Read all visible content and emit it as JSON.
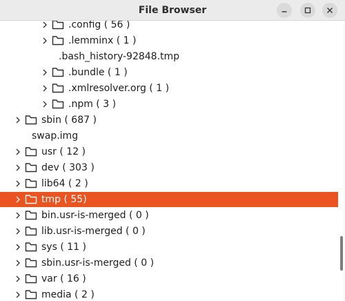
{
  "window": {
    "title": "File Browser"
  },
  "icons": {
    "minimize": "minimize-icon",
    "maximize": "maximize-icon",
    "close": "close-icon",
    "expander": "chevron-right-icon",
    "folder": "folder-icon"
  },
  "colors": {
    "selection": "#e95420",
    "titlebar": "#ebebeb",
    "text": "#1e1e1e"
  },
  "tree": {
    "selected_label": "tmp ( 55)",
    "rows": [
      {
        "label": ".config ( 56 )",
        "type": "folder",
        "depth": 2,
        "expandable": true
      },
      {
        "label": ".lemminx ( 1 )",
        "type": "folder",
        "depth": 2,
        "expandable": true
      },
      {
        "label": ".bash_history-92848.tmp",
        "type": "file",
        "depth": 2,
        "expandable": false
      },
      {
        "label": ".bundle ( 1 )",
        "type": "folder",
        "depth": 2,
        "expandable": true
      },
      {
        "label": ".xmlresolver.org ( 1 )",
        "type": "folder",
        "depth": 2,
        "expandable": true
      },
      {
        "label": ".npm ( 3 )",
        "type": "folder",
        "depth": 2,
        "expandable": true
      },
      {
        "label": "sbin ( 687 )",
        "type": "folder",
        "depth": 1,
        "expandable": true
      },
      {
        "label": "swap.img",
        "type": "file",
        "depth": 1,
        "expandable": false
      },
      {
        "label": "usr ( 12 )",
        "type": "folder",
        "depth": 1,
        "expandable": true
      },
      {
        "label": "dev ( 303 )",
        "type": "folder",
        "depth": 1,
        "expandable": true
      },
      {
        "label": "lib64 ( 2 )",
        "type": "folder",
        "depth": 1,
        "expandable": true
      },
      {
        "label": "tmp ( 55)",
        "type": "folder",
        "depth": 1,
        "expandable": true,
        "selected": true
      },
      {
        "label": "bin.usr-is-merged ( 0 )",
        "type": "folder",
        "depth": 1,
        "expandable": true
      },
      {
        "label": "lib.usr-is-merged ( 0 )",
        "type": "folder",
        "depth": 1,
        "expandable": true
      },
      {
        "label": "sys ( 11 )",
        "type": "folder",
        "depth": 1,
        "expandable": true
      },
      {
        "label": "sbin.usr-is-merged ( 0 )",
        "type": "folder",
        "depth": 1,
        "expandable": true
      },
      {
        "label": "var ( 16 )",
        "type": "folder",
        "depth": 1,
        "expandable": true
      },
      {
        "label": "media ( 2 )",
        "type": "folder",
        "depth": 1,
        "expandable": true
      }
    ]
  }
}
